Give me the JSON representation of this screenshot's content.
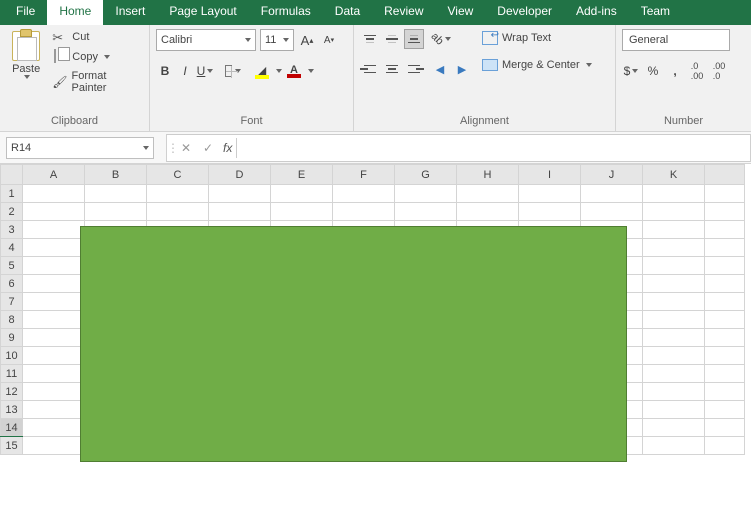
{
  "tabs": {
    "file": "File",
    "home": "Home",
    "insert": "Insert",
    "pagelayout": "Page Layout",
    "formulas": "Formulas",
    "data": "Data",
    "review": "Review",
    "view": "View",
    "developer": "Developer",
    "addins": "Add-ins",
    "team": "Team"
  },
  "clipboard": {
    "paste": "Paste",
    "cut": "Cut",
    "copy": "Copy",
    "format_painter": "Format Painter",
    "group_label": "Clipboard"
  },
  "font": {
    "name": "Calibri",
    "size": "11",
    "increase": "A",
    "decrease": "A",
    "bold": "B",
    "italic": "I",
    "underline": "U",
    "fill_letter": "A",
    "color_letter": "A",
    "group_label": "Font"
  },
  "alignment": {
    "wrap": "Wrap Text",
    "merge": "Merge & Center",
    "group_label": "Alignment"
  },
  "number": {
    "format": "General",
    "currency": "$",
    "percent": "%",
    "comma": ",",
    "inc_dec": "←.0",
    "dec_dec": ".00→",
    "group_label": "Number"
  },
  "namebox": {
    "ref": "R14"
  },
  "fx": {
    "cancel": "✕",
    "enter": "✓",
    "label": "fx"
  },
  "columns": [
    "A",
    "B",
    "C",
    "D",
    "E",
    "F",
    "G",
    "H",
    "I",
    "J",
    "K"
  ],
  "rows": [
    "1",
    "2",
    "3",
    "4",
    "5",
    "6",
    "7",
    "8",
    "9",
    "10",
    "11",
    "12",
    "13",
    "14",
    "15"
  ],
  "selected_row": "14",
  "shape": {
    "color": "#70ad47"
  }
}
